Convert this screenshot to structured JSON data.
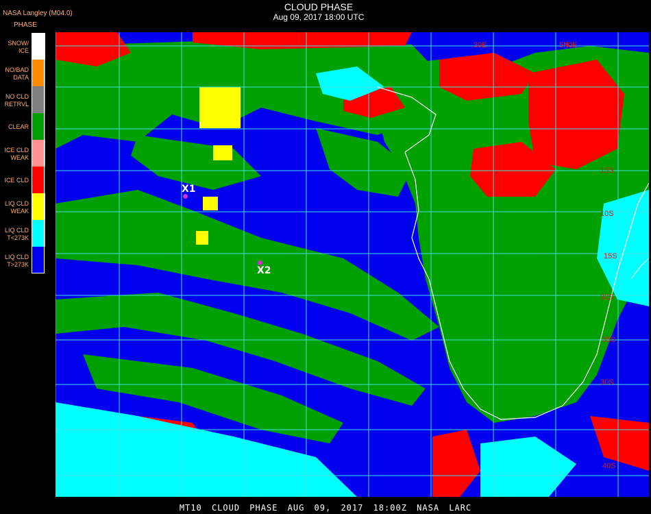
{
  "header": {
    "org": "NASA Langley (M04.0)",
    "title": "CLOUD PHASE",
    "datetime": "Aug 09, 2017 18:00 UTC"
  },
  "legend": {
    "title": "PHASE",
    "items": [
      {
        "label": "SNOW/\nICE",
        "color": "#ffffff"
      },
      {
        "label": "NO/BAD\nDATA",
        "color": "#ff8c00"
      },
      {
        "label": "NO CLD\nRETRVL",
        "color": "#808080"
      },
      {
        "label": "CLEAR",
        "color": "#00a000"
      },
      {
        "label": "ICE CLD\nWEAK",
        "color": "#ff9090"
      },
      {
        "label": "ICE CLD",
        "color": "#ff0000"
      },
      {
        "label": "LIQ CLD\nWEAK",
        "color": "#ffff00"
      },
      {
        "label": "LIQ CLD\nT<273K",
        "color": "#00ffff"
      },
      {
        "label": "LIQ CLD\nT>273K",
        "color": "#0000ee"
      }
    ]
  },
  "markers": [
    {
      "label": "X1"
    },
    {
      "label": "X2"
    }
  ],
  "grid_labels": [
    "30E",
    "5N",
    "40E",
    "15S",
    "10S",
    "15S",
    "30S",
    "35S",
    "30S",
    "40S"
  ],
  "footer": "MT10 CLOUD PHASE AUG 09, 2017 18:00Z NASA LARC",
  "colors": {
    "grid": "#40e0e0",
    "coast": "#ffffff",
    "grid_label": "#cc2222"
  }
}
